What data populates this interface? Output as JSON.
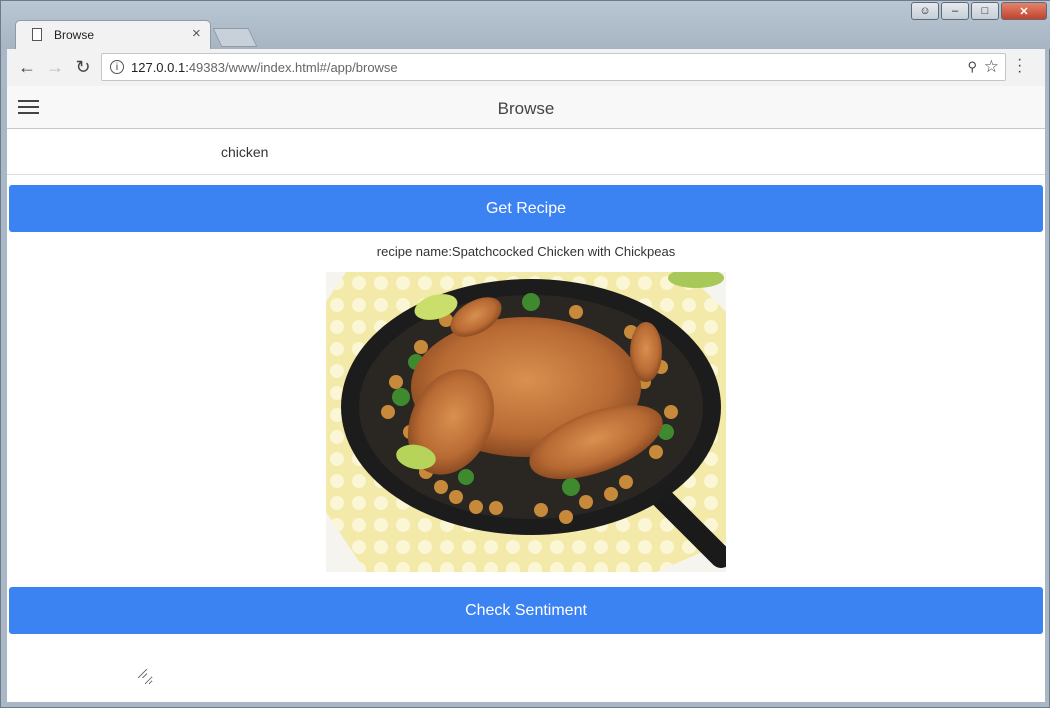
{
  "browser": {
    "tab_title": "Browse",
    "url_host": "127.0.0.1:",
    "url_rest": "49383/www/index.html#/app/browse"
  },
  "app": {
    "header_title": "Browse",
    "search": {
      "value": "chicken",
      "placeholder": ""
    },
    "get_recipe_label": "Get Recipe",
    "recipe_name": "recipe name:Spatchcocked Chicken with Chickpeas",
    "image_alt": "Spatchcocked Chicken with Chickpeas",
    "check_sentiment_label": "Check Sentiment",
    "sentiment_text": ""
  },
  "colors": {
    "primary_button": "#3b82f2",
    "header_bg": "#f8f8f8"
  },
  "icons": [
    "page-icon",
    "close-icon",
    "back-icon",
    "forward-icon",
    "reload-icon",
    "info-icon",
    "key-icon",
    "star-icon",
    "menu-dots-icon",
    "hamburger-icon"
  ]
}
